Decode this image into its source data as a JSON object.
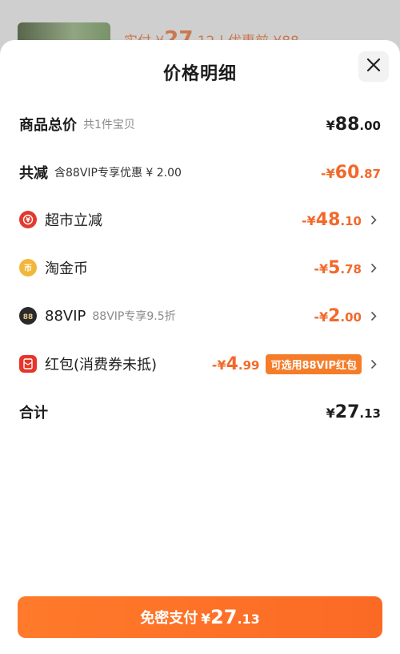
{
  "background": {
    "text_prefix": "实付 ¥",
    "text_big": "27",
    "text_suffix": ".12 | 优惠前 ¥88"
  },
  "sheet": {
    "title": "价格明细",
    "close_icon": "close-icon"
  },
  "rows": {
    "total": {
      "label": "商品总价",
      "sub": "共1件宝贝",
      "yen": "¥",
      "int": "88",
      "dec": ".00"
    },
    "reduction": {
      "label": "共减",
      "sub": "含88VIP专享优惠 ¥ 2.00",
      "yen": "-¥",
      "int": "60",
      "dec": ".87"
    },
    "supermarket": {
      "label": "超市立减",
      "yen": "-¥",
      "int": "48",
      "dec": ".10",
      "icon": "supermarket-icon"
    },
    "coin": {
      "label": "淘金币",
      "yen": "-¥",
      "int": "5",
      "dec": ".78",
      "icon": "coin-icon"
    },
    "vip": {
      "label": "88VIP",
      "sub": "88VIP专享9.5折",
      "yen": "-¥",
      "int": "2",
      "dec": ".00",
      "icon": "vip-icon"
    },
    "redpack": {
      "label": "红包(消费券未抵)",
      "yen": "-¥",
      "int": "4",
      "dec": ".99",
      "tag": "可选用88VIP红包",
      "icon": "red-packet-icon"
    },
    "sum": {
      "label": "合计",
      "yen": "¥",
      "int": "27",
      "dec": ".13"
    }
  },
  "pay_button": {
    "label": "免密支付",
    "yen": "¥",
    "int": "27",
    "dec": ".13"
  },
  "colors": {
    "accent": "#f2692b",
    "button": "#fb6a25"
  }
}
